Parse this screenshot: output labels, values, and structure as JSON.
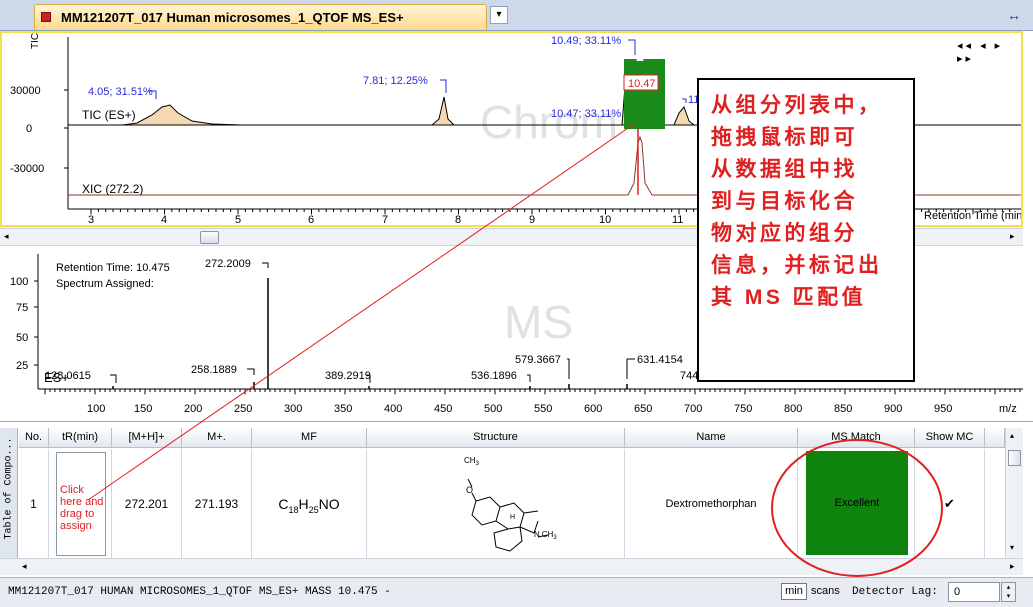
{
  "window": {
    "tab_title": "MM121207T_017 Human microsomes_1_QTOF MS_ES+",
    "dropdown_glyph": "▾",
    "maximize_glyph": "↔"
  },
  "chromatogram": {
    "nav": "◂◂ ◂ ▸ ▸▸",
    "yaxis_label": "TIC",
    "watermark": "Chrom",
    "y_ticks": [
      "30000",
      "0",
      "-30000"
    ],
    "x_ticks": [
      "3",
      "4",
      "5",
      "6",
      "7",
      "8",
      "9",
      "10",
      "11"
    ],
    "x_axis_label": "Retention Time (min)",
    "trace_tic_label": "TIC (ES+)",
    "trace_xic_label": "XIC (272.2)",
    "peak_labels": [
      "4.05; 31.51%",
      "7.81; 12.25%",
      "10.49; 33.11%",
      "10.47; 33.11%",
      "11"
    ],
    "marker_label": "10.47",
    "selected_rt": 10.47
  },
  "ms": {
    "watermark": "MS",
    "retention_time_text": "Retention Time: 10.475",
    "spectrum_assigned_text": "Spectrum Assigned:",
    "source_label": "ES+",
    "y_ticks": [
      "100",
      "75",
      "50",
      "25"
    ],
    "x_ticks": [
      "100",
      "150",
      "200",
      "250",
      "300",
      "350",
      "400",
      "450",
      "500",
      "550",
      "600",
      "650",
      "700",
      "750",
      "800",
      "850",
      "900",
      "950"
    ],
    "x_unit": "m/z",
    "peak_labels": [
      "272.2009",
      "258.1889",
      "389.2919",
      "579.3667",
      "536.1896",
      "631.4154",
      "744",
      "128.0615"
    ]
  },
  "table": {
    "side_label": "Table of Compo...",
    "columns": [
      "No.",
      "tR(min)",
      "[M+H]+",
      "M+.",
      "MF",
      "Structure",
      "Name",
      "MS Match",
      "Show MC"
    ],
    "rows": [
      {
        "no": "1",
        "tr_hint": "Click here and drag to assign",
        "mh": "272.201",
        "m": "271.193",
        "mf_base": "C",
        "mf_c": "18",
        "mf_h": "H",
        "mf_hn": "25",
        "mf_rest": "NO",
        "name": "Dextromethorphan",
        "ms_match": "Excellent",
        "show_mc": "✔"
      }
    ]
  },
  "structure_labels": {
    "methyl_top": "CH",
    "methyl_top_sub": "3",
    "oxygen": "O",
    "h_label": "H",
    "n_methyl": "N",
    "n_methyl_ch": "CH",
    "n_methyl_sub": "3"
  },
  "status": {
    "text": "MM121207T_017 HUMAN MICROSOMES_1_QTOF MS_ES+   MASS  10.475  -",
    "min_button": "min",
    "scans_label": "scans",
    "detector_lag_label": "Detector Lag:",
    "detector_lag_value": "0"
  },
  "annotation": {
    "lines": [
      "从组分列表中，",
      "拖拽鼠标即可",
      "从数据组中找",
      "到与目标化合",
      "物对应的组分",
      "信息，并标记出",
      "其 MS 匹配值"
    ]
  },
  "colors": {
    "peak_fill": "#f5d9b2",
    "selected_peak": "#1a8a1a",
    "ms_match_excellent": "#0e830e",
    "annotation_red": "#e02020",
    "chrom_border": "#f4e04a",
    "label_blue": "#2a2ae0"
  }
}
